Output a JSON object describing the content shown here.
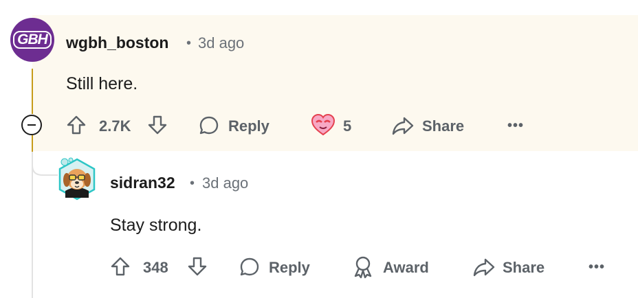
{
  "comment": {
    "username": "wgbh_boston",
    "avatar_text": "GBH",
    "separator": "•",
    "time": "3d ago",
    "body": "Still here.",
    "upvotes": "2.7K",
    "reply_label": "Reply",
    "award_count": "5",
    "share_label": "Share",
    "more_label": "•••"
  },
  "reply": {
    "username": "sidran32",
    "separator": "•",
    "time": "3d ago",
    "body": "Stay strong.",
    "upvotes": "348",
    "reply_label": "Reply",
    "award_label": "Award",
    "share_label": "Share",
    "more_label": "•••"
  },
  "colors": {
    "highlight_bg": "#fdf9ef",
    "thread_line": "#c69c1a",
    "avatar_bg": "#6d2d91",
    "text_muted": "#6b7178"
  }
}
